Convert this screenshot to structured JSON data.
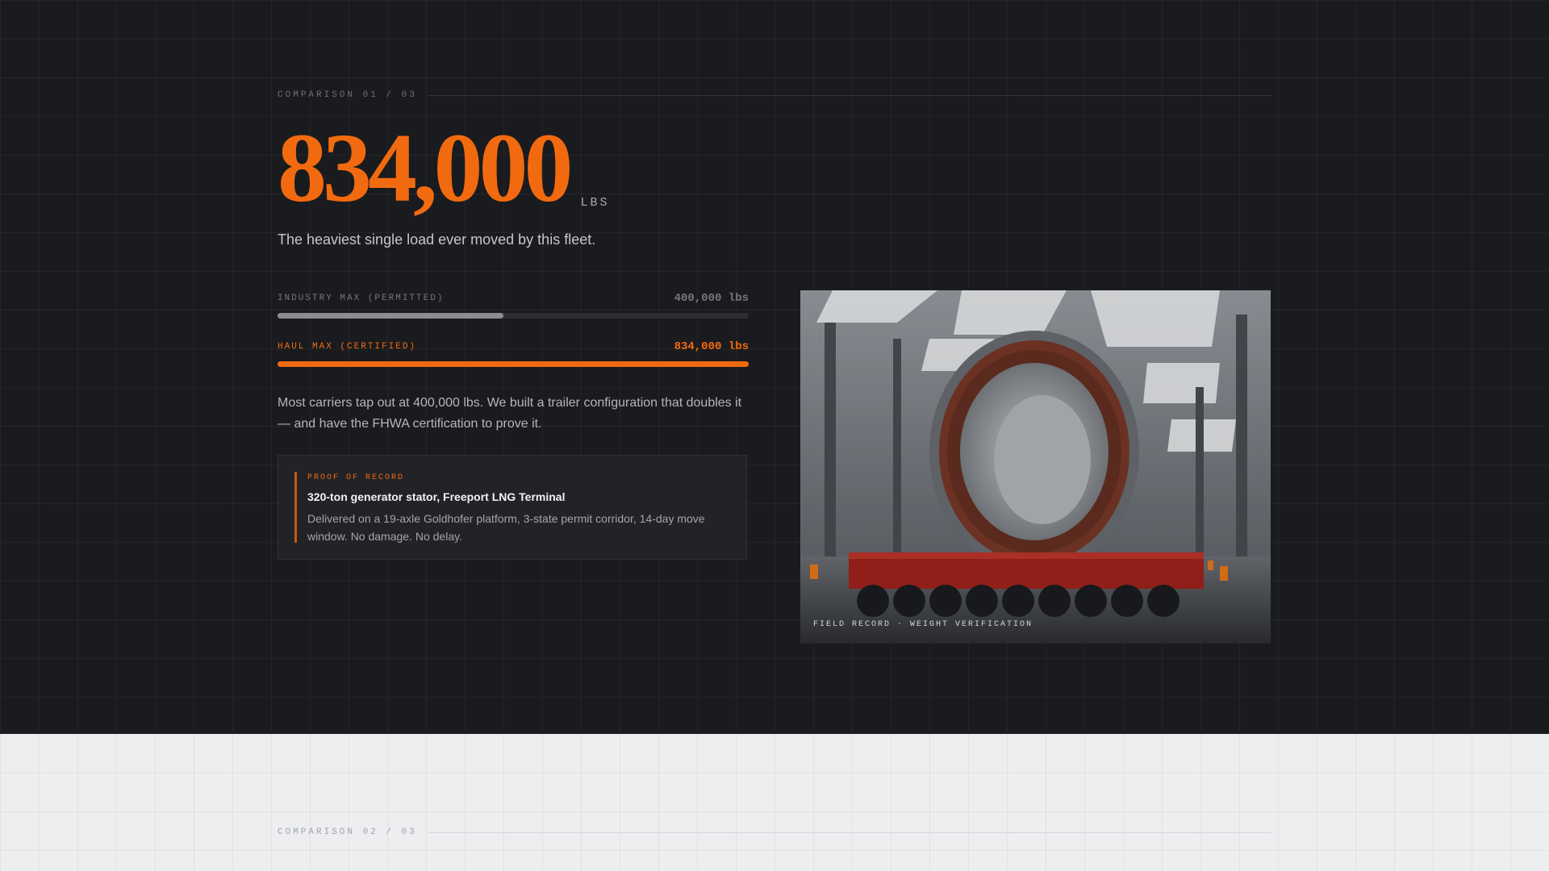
{
  "comparison_1": {
    "kicker": "COMPARISON 01 / 03",
    "headline_value": "834,000",
    "headline_unit": "LBS",
    "tagline": "The heaviest single load ever moved by this fleet.",
    "bars": [
      {
        "label": "INDUSTRY MAX (PERMITTED)",
        "value_text": "400,000 lbs",
        "value": 400000,
        "fill_fraction": 0.48,
        "color": "#8a8c90"
      },
      {
        "label": "HAUL MAX (CERTIFIED)",
        "value_text": "834,000 lbs",
        "value": 834000,
        "fill_fraction": 1.0,
        "color": "#f26a10"
      }
    ],
    "body": "Most carriers tap out at 400,000 lbs. We built a trailer configuration that doubles it — and have the FHWA certification to prove it.",
    "proof": {
      "tag": "PROOF OF RECORD",
      "title": "320-ton generator stator, Freeport LNG Terminal",
      "description": "Delivered on a 19-axle Goldhofer platform, 3-state permit corridor, 14-day move window. No damage. No delay."
    },
    "photo_caption": "FIELD RECORD · WEIGHT VERIFICATION"
  },
  "comparison_2": {
    "kicker": "COMPARISON 02 / 03"
  },
  "colors": {
    "accent": "#f26a10",
    "dark_bg": "#1a1b1e",
    "light_bg": "#edeef0"
  }
}
